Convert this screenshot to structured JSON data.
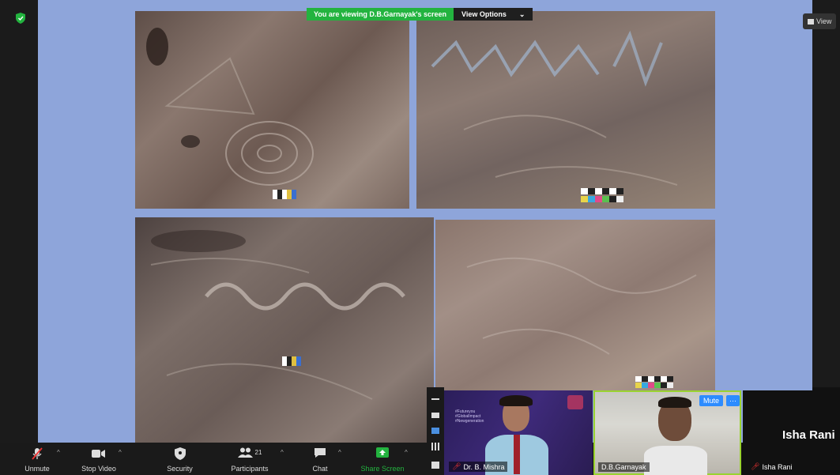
{
  "banner": {
    "viewing_text": "You are viewing D.B.Garnayak's screen",
    "view_options_label": "View Options"
  },
  "view_button_label": "View",
  "colors": {
    "shared_bg": "#8ea5da",
    "accent_green": "#23b33f",
    "toolbar_bg": "#1a1a1a",
    "mute_blue": "#2d8cff"
  },
  "toolbar": {
    "unmute_label": "Unmute",
    "stop_video_label": "Stop Video",
    "security_label": "Security",
    "participants_label": "Participants",
    "participants_count": "21",
    "chat_label": "Chat",
    "share_screen_label": "Share Screen"
  },
  "videos": [
    {
      "name": "Dr. B. Mishra",
      "muted": true
    },
    {
      "name": "D.B.Garnayak",
      "muted": false,
      "mute_button_label": "Mute",
      "more_label": "···"
    },
    {
      "name": "Isha Rani",
      "muted": true,
      "large_name": "Isha Rani"
    }
  ],
  "tile1_text": {
    "hashtags": [
      "#Futureyou",
      "#GlobalImpact",
      "#Newgeneration"
    ]
  }
}
